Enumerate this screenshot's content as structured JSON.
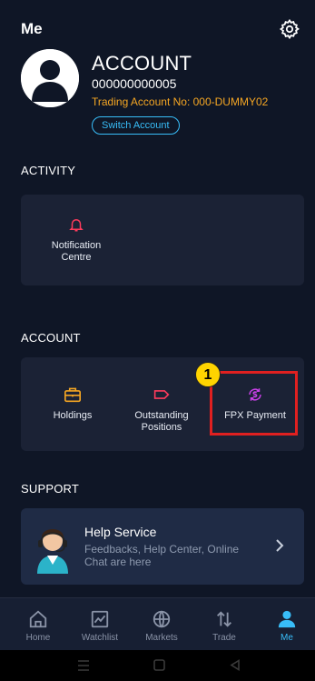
{
  "header": {
    "title": "Me",
    "settings_icon": "gear-icon"
  },
  "profile": {
    "account_title": "ACCOUNT",
    "account_number": "000000000005",
    "trading_account": "Trading Account No: 000-DUMMY02",
    "switch_label": "Switch Account",
    "avatar_icon": "user-icon"
  },
  "activity": {
    "title": "ACTIVITY",
    "items": [
      {
        "line1": "Notification",
        "line2": "Centre",
        "icon": "bell-icon"
      }
    ]
  },
  "account": {
    "title": "ACCOUNT",
    "items": [
      {
        "line1": "Holdings",
        "line2": "",
        "icon": "briefcase-icon"
      },
      {
        "line1": "Outstanding",
        "line2": "Positions",
        "icon": "tag-icon"
      },
      {
        "line1": "FPX Payment",
        "line2": "",
        "icon": "currency-exchange-icon"
      }
    ],
    "step_badge": "1"
  },
  "support": {
    "title": "SUPPORT",
    "help_title": "Help Service",
    "help_desc": "Feedbacks, Help Center, Online Chat are here"
  },
  "tabs": [
    {
      "label": "Home",
      "icon": "home-icon"
    },
    {
      "label": "Watchlist",
      "icon": "chart-icon"
    },
    {
      "label": "Markets",
      "icon": "globe-icon"
    },
    {
      "label": "Trade",
      "icon": "trade-arrows-icon"
    },
    {
      "label": "Me",
      "icon": "person-icon",
      "active": true
    }
  ],
  "colors": {
    "background": "#0f1626",
    "card": "#1b2235",
    "accent": "#38bdf8",
    "orange": "#f5a623",
    "red": "#ff3b5c",
    "purple": "#c940e8",
    "highlight": "#e02020"
  }
}
